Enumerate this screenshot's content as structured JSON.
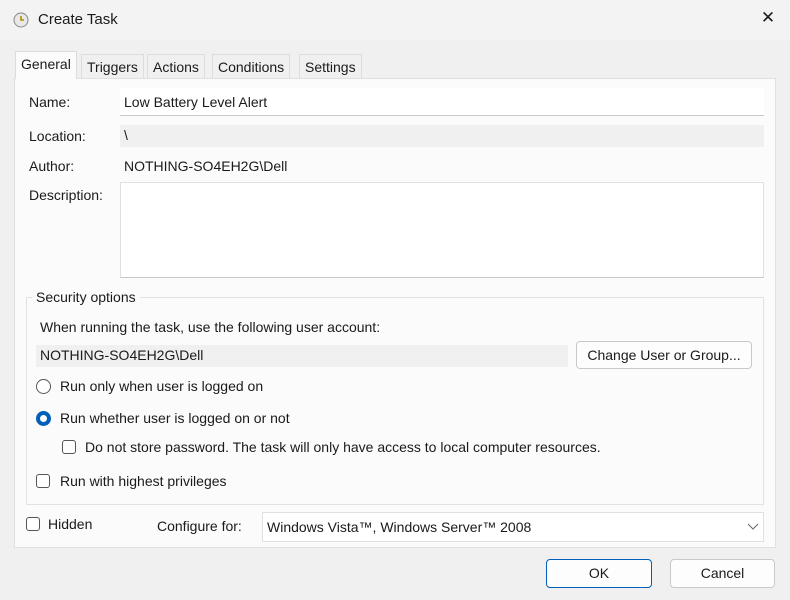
{
  "window": {
    "title": "Create Task",
    "close": "✕"
  },
  "tabs": [
    "General",
    "Triggers",
    "Actions",
    "Conditions",
    "Settings"
  ],
  "general": {
    "name_label": "Name:",
    "name_value": "Low Battery Level Alert",
    "location_label": "Location:",
    "location_value": "\\",
    "author_label": "Author:",
    "author_value": "NOTHING-SO4EH2G\\Dell",
    "description_label": "Description:",
    "description_value": ""
  },
  "security": {
    "legend": "Security options",
    "account_prompt": "When running the task, use the following user account:",
    "account_value": "NOTHING-SO4EH2G\\Dell",
    "change_button": "Change User or Group...",
    "radio_logged_on": "Run only when user is logged on",
    "radio_whether": "Run whether user is logged on or not",
    "radio_selected": "whether",
    "no_store_password": "Do not store password.  The task will only have access to local computer resources.",
    "highest_privileges": "Run with highest privileges"
  },
  "hidden_label": "Hidden",
  "configure_label": "Configure for:",
  "configure_value": "Windows Vista™, Windows Server™ 2008",
  "ok": "OK",
  "cancel": "Cancel"
}
